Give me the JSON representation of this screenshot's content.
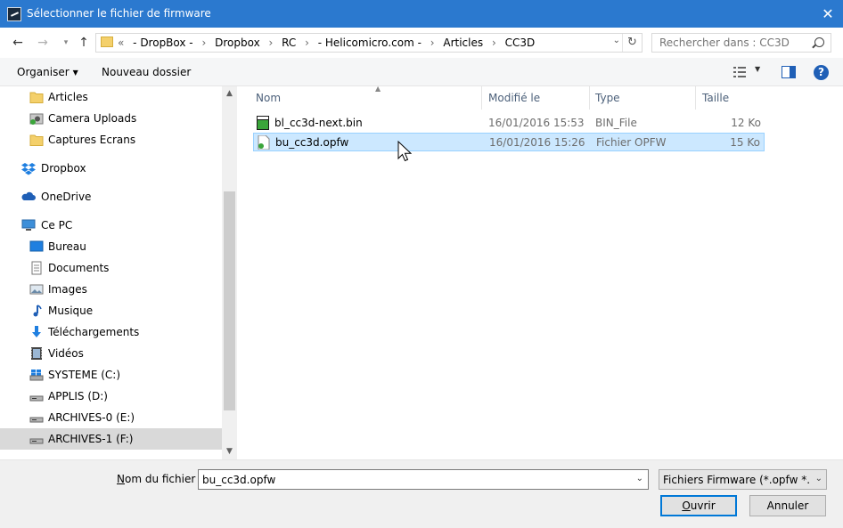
{
  "window": {
    "title": "Sélectionner le fichier de firmware"
  },
  "address": {
    "crumbs": [
      "«",
      "- DropBox -",
      "›",
      "Dropbox",
      "›",
      "RC",
      "›",
      "- Helicomicro.com -",
      "›",
      "Articles",
      "›",
      "CC3D"
    ],
    "search_placeholder": "Rechercher dans : CC3D"
  },
  "toolbar": {
    "organize_label": "Organiser",
    "new_folder_label": "Nouveau dossier"
  },
  "sidebar": {
    "items": [
      {
        "label": "Articles",
        "icon": "folder-icon"
      },
      {
        "label": "Camera Uploads",
        "icon": "camera-folder-icon"
      },
      {
        "label": "Captures Ecrans",
        "icon": "folder-icon"
      },
      {
        "label": "Dropbox",
        "icon": "dropbox-icon"
      },
      {
        "label": "OneDrive",
        "icon": "onedrive-icon"
      },
      {
        "label": "Ce PC",
        "icon": "computer-icon"
      },
      {
        "label": "Bureau",
        "icon": "desktop-icon"
      },
      {
        "label": "Documents",
        "icon": "documents-icon"
      },
      {
        "label": "Images",
        "icon": "images-icon"
      },
      {
        "label": "Musique",
        "icon": "music-icon"
      },
      {
        "label": "Téléchargements",
        "icon": "download-icon"
      },
      {
        "label": "Vidéos",
        "icon": "videos-icon"
      },
      {
        "label": "SYSTEME (C:)",
        "icon": "windows-drive-icon"
      },
      {
        "label": "APPLIS (D:)",
        "icon": "drive-icon"
      },
      {
        "label": "ARCHIVES-0 (E:)",
        "icon": "drive-icon"
      },
      {
        "label": "ARCHIVES-1 (F:)",
        "icon": "drive-icon"
      }
    ]
  },
  "filelist": {
    "columns": [
      "Nom",
      "Modifié le",
      "Type",
      "Taille"
    ],
    "rows": [
      {
        "name": "bl_cc3d-next.bin",
        "date": "16/01/2016 15:53",
        "type": "BIN_File",
        "size": "12 Ko"
      },
      {
        "name": "bu_cc3d.opfw",
        "date": "16/01/2016 15:26",
        "type": "Fichier OPFW",
        "size": "15 Ko"
      }
    ]
  },
  "bottom": {
    "filename_label_pre": "",
    "filename_label_u": "N",
    "filename_label_post": "om du fichier :",
    "filename_value": "bu_cc3d.opfw",
    "filter_value": "Fichiers Firmware (*.opfw *.bin)",
    "open_u": "O",
    "open_rest": "uvrir",
    "cancel_label": "Annuler"
  },
  "colors": {
    "titlebar": "#2b79cf",
    "selection": "#cce8ff",
    "accent": "#0078d7"
  }
}
